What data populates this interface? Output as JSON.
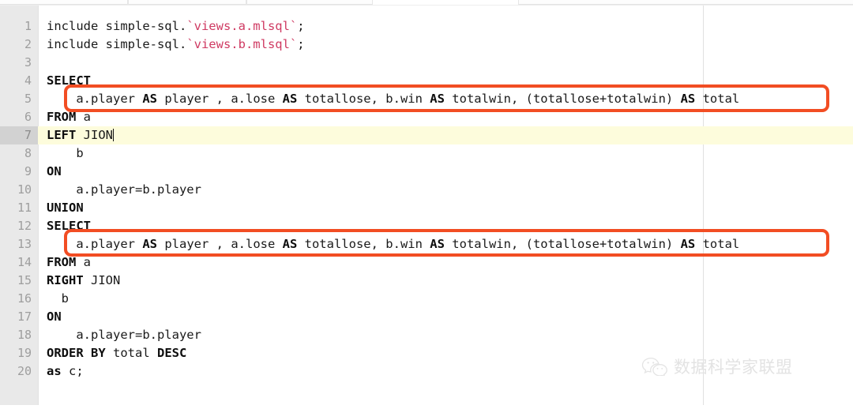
{
  "window": {
    "app": "code-editor",
    "tab_strip_visible": true,
    "tabs": [
      {
        "label": ""
      },
      {
        "label": ""
      },
      {
        "label": ""
      },
      {
        "label": ""
      }
    ]
  },
  "editor": {
    "language": "mlsql",
    "active_line": 7,
    "cursor_line": 7,
    "cursor_column": 10,
    "print_margin_column": 80,
    "colors": {
      "background": "#ffffff",
      "gutter_background": "#e9e9e9",
      "gutter_text": "#9e9e9e",
      "active_line_background": "#fdfcdc",
      "active_gutter_background": "#d2d2d2",
      "keyword": "#0d0d0d",
      "string": "#cf3a62",
      "text": "#1a1a1a",
      "ruler": "#e0e0e0",
      "annotation": "#f24d23"
    },
    "line_numbers": [
      "1",
      "2",
      "3",
      "4",
      "5",
      "6",
      "7",
      "8",
      "9",
      "10",
      "11",
      "12",
      "13",
      "14",
      "15",
      "16",
      "17",
      "18",
      "19",
      "20"
    ],
    "lines": [
      {
        "n": 1,
        "tokens": [
          {
            "t": "include simple-sql.",
            "k": "plain"
          },
          {
            "t": "`views.a.mlsql`",
            "k": "str"
          },
          {
            "t": ";",
            "k": "plain"
          }
        ]
      },
      {
        "n": 2,
        "tokens": [
          {
            "t": "include simple-sql.",
            "k": "plain"
          },
          {
            "t": "`views.b.mlsql`",
            "k": "str"
          },
          {
            "t": ";",
            "k": "plain"
          }
        ]
      },
      {
        "n": 3,
        "tokens": []
      },
      {
        "n": 4,
        "tokens": [
          {
            "t": "SELECT",
            "k": "kw"
          }
        ]
      },
      {
        "n": 5,
        "tokens": [
          {
            "t": "    a.player ",
            "k": "plain"
          },
          {
            "t": "AS",
            "k": "kw"
          },
          {
            "t": " player , a.lose ",
            "k": "plain"
          },
          {
            "t": "AS",
            "k": "kw"
          },
          {
            "t": " totallose, b.win ",
            "k": "plain"
          },
          {
            "t": "AS",
            "k": "kw"
          },
          {
            "t": " totalwin, (totallose+totalwin) ",
            "k": "plain"
          },
          {
            "t": "AS",
            "k": "kw"
          },
          {
            "t": " total",
            "k": "plain"
          }
        ]
      },
      {
        "n": 6,
        "tokens": [
          {
            "t": "FROM",
            "k": "kw"
          },
          {
            "t": " a",
            "k": "plain"
          }
        ]
      },
      {
        "n": 7,
        "tokens": [
          {
            "t": "LEFT",
            "k": "kw"
          },
          {
            "t": " JION",
            "k": "plain"
          }
        ]
      },
      {
        "n": 8,
        "tokens": [
          {
            "t": "    b",
            "k": "plain"
          }
        ]
      },
      {
        "n": 9,
        "tokens": [
          {
            "t": "ON",
            "k": "kw"
          }
        ]
      },
      {
        "n": 10,
        "tokens": [
          {
            "t": "    a.player=b.player",
            "k": "plain"
          }
        ]
      },
      {
        "n": 11,
        "tokens": [
          {
            "t": "UNION",
            "k": "kw"
          }
        ]
      },
      {
        "n": 12,
        "tokens": [
          {
            "t": "SELECT",
            "k": "kw"
          }
        ]
      },
      {
        "n": 13,
        "tokens": [
          {
            "t": "    a.player ",
            "k": "plain"
          },
          {
            "t": "AS",
            "k": "kw"
          },
          {
            "t": " player , a.lose ",
            "k": "plain"
          },
          {
            "t": "AS",
            "k": "kw"
          },
          {
            "t": " totallose, b.win ",
            "k": "plain"
          },
          {
            "t": "AS",
            "k": "kw"
          },
          {
            "t": " totalwin, (totallose+totalwin) ",
            "k": "plain"
          },
          {
            "t": "AS",
            "k": "kw"
          },
          {
            "t": " total",
            "k": "plain"
          }
        ]
      },
      {
        "n": 14,
        "tokens": [
          {
            "t": "FROM",
            "k": "kw"
          },
          {
            "t": " a",
            "k": "plain"
          }
        ]
      },
      {
        "n": 15,
        "tokens": [
          {
            "t": "RIGHT",
            "k": "kw"
          },
          {
            "t": " JION",
            "k": "plain"
          }
        ]
      },
      {
        "n": 16,
        "tokens": [
          {
            "t": "  b",
            "k": "plain"
          }
        ]
      },
      {
        "n": 17,
        "tokens": [
          {
            "t": "ON",
            "k": "kw"
          }
        ]
      },
      {
        "n": 18,
        "tokens": [
          {
            "t": "    a.player=b.player",
            "k": "plain"
          }
        ]
      },
      {
        "n": 19,
        "tokens": [
          {
            "t": "ORDER BY",
            "k": "kw"
          },
          {
            "t": " total ",
            "k": "plain"
          },
          {
            "t": "DESC",
            "k": "kw"
          }
        ]
      },
      {
        "n": 20,
        "tokens": [
          {
            "t": "as",
            "k": "kw"
          },
          {
            "t": " c;",
            "k": "plain"
          }
        ]
      }
    ]
  },
  "annotations": [
    {
      "name": "select-columns-box-1",
      "target_line": 5,
      "color": "#f24d23"
    },
    {
      "name": "select-columns-box-2",
      "target_line": 13,
      "color": "#f24d23"
    }
  ],
  "watermark": {
    "icon": "wechat-icon",
    "text": "数据科学家联盟",
    "color": "#e3e3e3"
  }
}
